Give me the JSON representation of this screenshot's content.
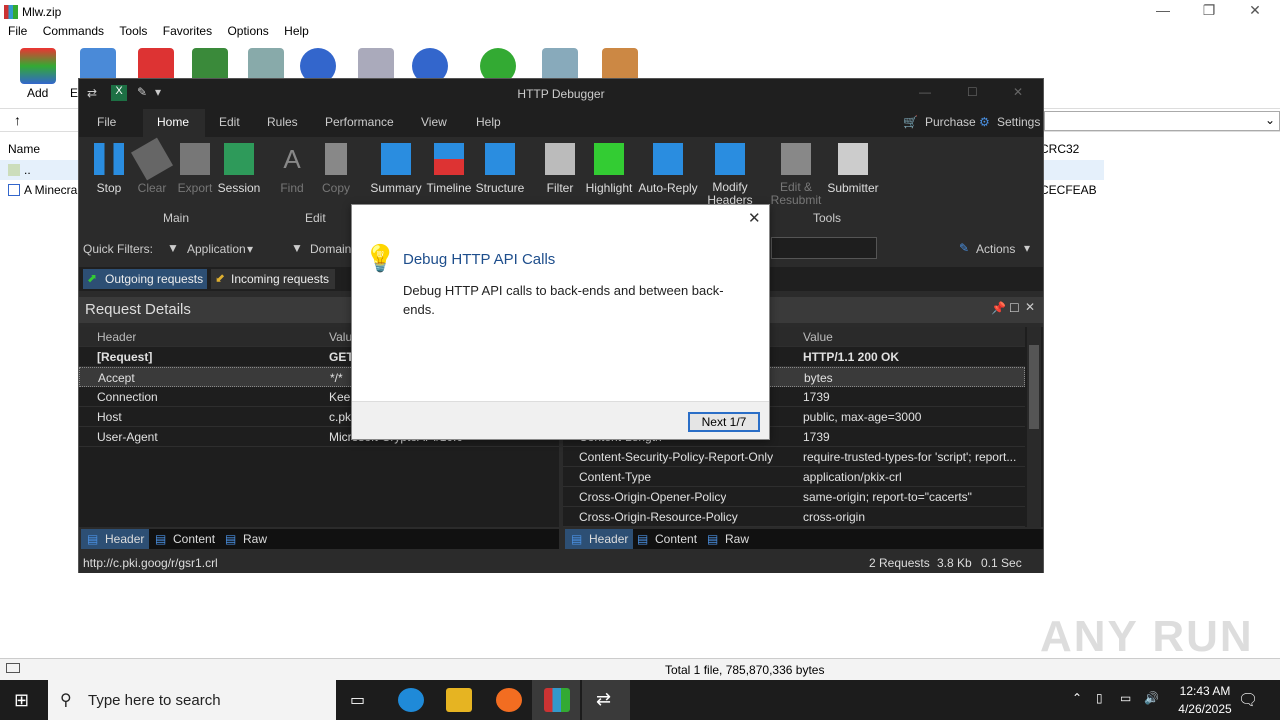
{
  "winrar": {
    "title": "Mlw.zip",
    "menu": [
      "File",
      "Commands",
      "Tools",
      "Favorites",
      "Options",
      "Help"
    ],
    "add_label": "Add",
    "ext_label": "E",
    "col_name": "Name",
    "col_crc": "CRC32",
    "row_up": "..",
    "row_file": "A Minecra",
    "crc_value": "CECFEAB",
    "status": "Total 1 file, 785,870,336 bytes"
  },
  "taskbar": {
    "search_placeholder": "Type here to search",
    "time": "12:43 AM",
    "date": "4/26/2025"
  },
  "hd": {
    "title": "HTTP Debugger",
    "tabs": [
      "File",
      "Home",
      "Edit",
      "Rules",
      "Performance",
      "View",
      "Help"
    ],
    "purchase": "Purchase",
    "settings": "Settings",
    "ribbon": [
      {
        "label": "Stop",
        "dis": false
      },
      {
        "label": "Clear",
        "dis": true
      },
      {
        "label": "Export",
        "dis": true
      },
      {
        "label": "Session",
        "dis": false
      },
      {
        "label": "Find",
        "dis": true
      },
      {
        "label": "Copy",
        "dis": true
      },
      {
        "label": "Summary",
        "dis": false
      },
      {
        "label": "Timeline",
        "dis": false
      },
      {
        "label": "Structure",
        "dis": false
      },
      {
        "label": "Filter",
        "dis": false
      },
      {
        "label": "Highlight",
        "dis": false
      },
      {
        "label": "Auto-Reply",
        "dis": false
      },
      {
        "label": "Modify Headers",
        "dis": false
      },
      {
        "label": "Edit & Resubmit",
        "dis": true
      },
      {
        "label": "Submitter",
        "dis": false
      }
    ],
    "groups": {
      "main": "Main",
      "edit": "Edit",
      "tools": "Tools"
    },
    "quick_filters": "Quick Filters:",
    "qf_application": "Application",
    "qf_domain": "Domain",
    "actions": "Actions",
    "outgoing": "Outgoing requests",
    "incoming": "Incoming requests",
    "request_details": "Request Details",
    "left_headers": [
      "Header",
      "Valu"
    ],
    "left_rows": [
      [
        "[Request]",
        "GET"
      ],
      [
        "Accept",
        "*/*"
      ],
      [
        "Connection",
        "Keep"
      ],
      [
        "Host",
        "c.pk"
      ],
      [
        "User-Agent",
        "Microsoft-CryptoAPI/10.0"
      ]
    ],
    "right_header_value": "Value",
    "right_rows": [
      [
        "",
        "HTTP/1.1 200 OK"
      ],
      [
        "",
        "bytes"
      ],
      [
        "",
        "1739"
      ],
      [
        "",
        "public, max-age=3000"
      ],
      [
        "Content-Length",
        "1739"
      ],
      [
        "Content-Security-Policy-Report-Only",
        "require-trusted-types-for 'script'; report..."
      ],
      [
        "Content-Type",
        "application/pkix-crl"
      ],
      [
        "Cross-Origin-Opener-Policy",
        "same-origin; report-to=\"cacerts\""
      ],
      [
        "Cross-Origin-Resource-Policy",
        "cross-origin"
      ]
    ],
    "ctabs": [
      "Header",
      "Content",
      "Raw"
    ],
    "status_url": "http://c.pki.goog/r/gsr1.crl",
    "status_requests": "2 Requests",
    "status_size": "3.8 Kb",
    "status_time": "0.1 Sec"
  },
  "dialog": {
    "title": "Debug HTTP API Calls",
    "body": "Debug HTTP API calls to back-ends and between back-ends.",
    "next": "Next 1/7"
  },
  "watermark": "ANY RUN"
}
